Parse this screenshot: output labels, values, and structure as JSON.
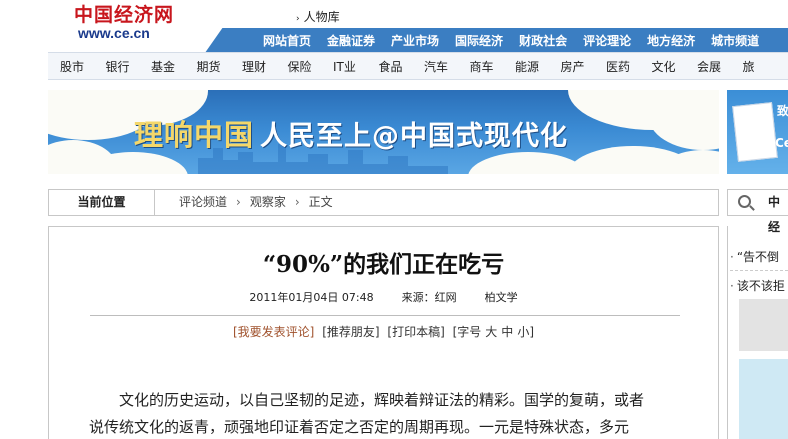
{
  "header": {
    "logo_cn": "中国经济网",
    "logo_url": "www.ce.cn",
    "top_link": "人物库"
  },
  "main_nav": [
    "网站首页",
    "金融证券",
    "产业市场",
    "国际经济",
    "财政社会",
    "评论理论",
    "地方经济",
    "城市频道"
  ],
  "sub_nav": [
    "股市",
    "银行",
    "基金",
    "期货",
    "理财",
    "保险",
    "IT业",
    "食品",
    "汽车",
    "商车",
    "能源",
    "房产",
    "医药",
    "文化",
    "会展",
    "旅"
  ],
  "banner": {
    "title_part1": "理响中国",
    "title_part2": "人民至上@中国式现代化"
  },
  "side_banner": {
    "text_top": "致",
    "text_bottom": "Ce"
  },
  "breadcrumb": {
    "label": "当前位置",
    "items": [
      "评论频道",
      "观察家",
      "正文"
    ]
  },
  "side_search_label": "中经",
  "article": {
    "title": "“90%”的我们正在吃亏",
    "date": "2011年01月04日 07:48",
    "source": "来源：红网",
    "author": "柏文学",
    "tools": [
      "[我要发表评论]",
      "[推荐朋友]",
      "[打印本稿]",
      "[字号",
      "大",
      "中",
      "小]"
    ],
    "paragraphs": [
      "文化的历史运动，以自己坚韧的足迹，辉映着辩证法的精彩。国学的复萌，或者",
      "说传统文化的返青，顽强地印证着否定之否定的周期再现。一元是特殊状态，多元"
    ]
  },
  "side_list": [
    "“告不倒",
    "该不该拒"
  ],
  "colors": {
    "nav_blue": "#3b7ec2",
    "logo_red": "#c8161d",
    "logo_blue": "#1a3a8c",
    "banner_gold": "#f4d76a"
  }
}
